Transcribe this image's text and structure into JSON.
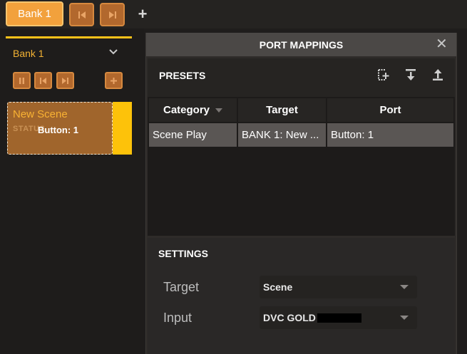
{
  "topbar": {
    "bank_tab_label": "Bank 1",
    "prev_icon": "skip-previous-icon",
    "next_icon": "skip-next-icon",
    "add_label": "+"
  },
  "left_panel": {
    "bank_name": "Bank 1",
    "scene": {
      "title": "New Scene",
      "status": "STATUS",
      "mapping": "Button: 1"
    }
  },
  "dialog": {
    "title": "PORT MAPPINGS",
    "close_label": "✕",
    "presets": {
      "title": "PRESETS",
      "icons": [
        "add-preset-icon",
        "import-icon",
        "export-icon"
      ]
    },
    "table": {
      "columns": [
        "Category",
        "Target",
        "Port"
      ],
      "rows": [
        {
          "category": "Scene Play",
          "target": "BANK 1: New ...",
          "port": "Button: 1"
        }
      ]
    },
    "settings": {
      "title": "SETTINGS",
      "target_label": "Target",
      "target_value": "Scene",
      "input_label": "Input",
      "input_value": "DVC GOLD"
    }
  },
  "colors": {
    "accent": "#f2a13c",
    "button_bg": "#b2682d",
    "scene_bg": "#a0652c",
    "highlight_yellow": "#fdc20a",
    "selected_row": "#5a5654"
  }
}
